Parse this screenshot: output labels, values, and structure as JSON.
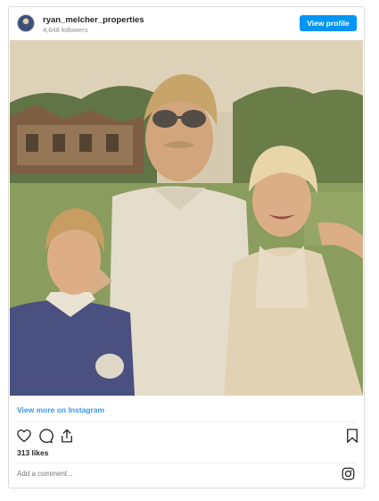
{
  "header": {
    "username": "ryan_melcher_properties",
    "followers": "4,648 followers",
    "view_profile_label": "View profile"
  },
  "post": {
    "image_alt": "",
    "view_more_label": "View more on Instagram",
    "likes": "313 likes",
    "comment_placeholder": "Add a comment..."
  },
  "icons": {
    "like": "heart-icon",
    "comment": "comment-icon",
    "share": "share-icon",
    "save": "bookmark-icon",
    "brand": "instagram-icon"
  },
  "colors": {
    "accent": "#0095f6",
    "link": "#3897f0",
    "border": "#dbdbdb",
    "muted": "#8e8e8e"
  }
}
